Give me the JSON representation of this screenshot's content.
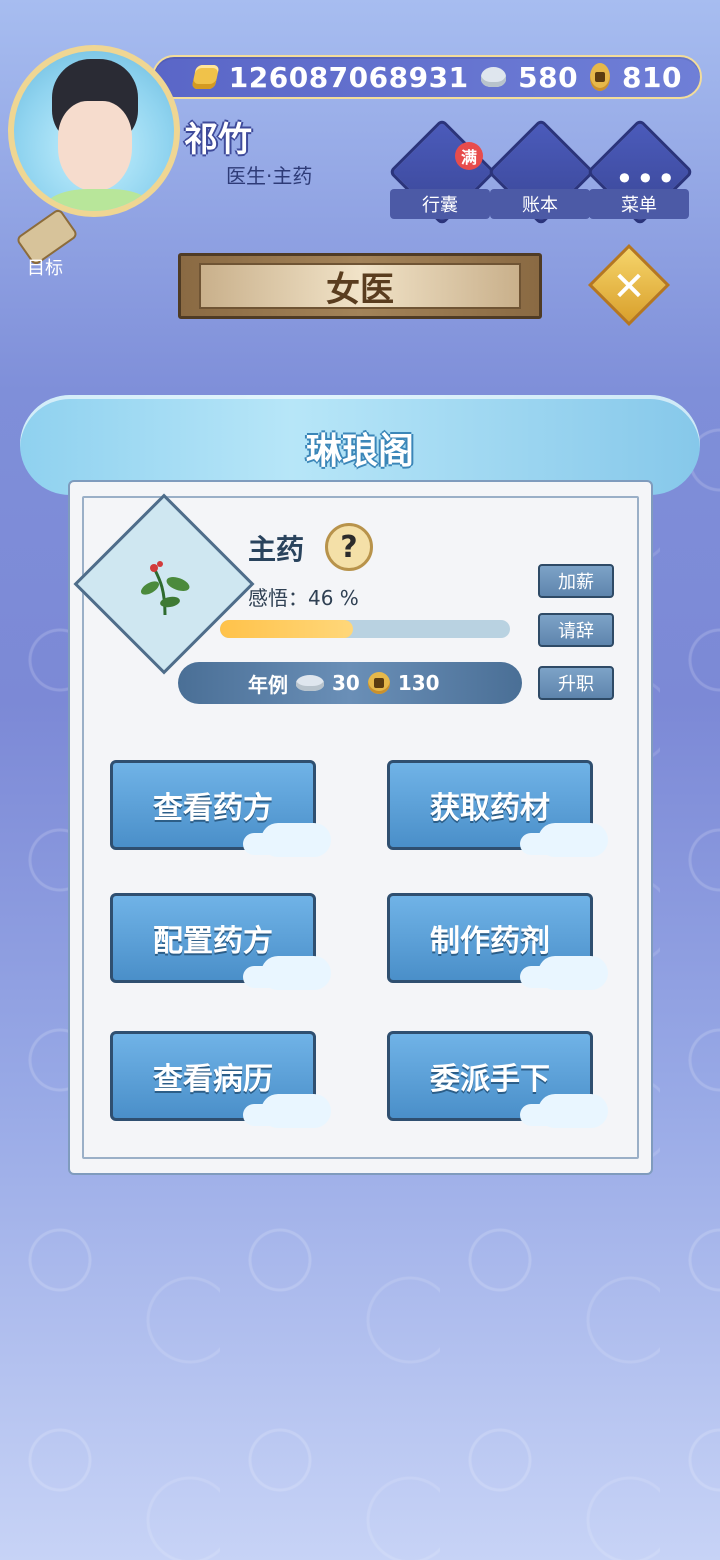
{
  "player": {
    "name": "祁竹",
    "role": "医生·主药",
    "currency": {
      "gold": "126087068931",
      "silver": "580",
      "coins": "810"
    }
  },
  "hud": {
    "buttons": [
      {
        "label": "行囊",
        "badge": "满"
      },
      {
        "label": "账本"
      },
      {
        "label": "菜单"
      }
    ],
    "target_label": "目标"
  },
  "screen": {
    "title": "女医",
    "close_symbol": "✕"
  },
  "panel": {
    "title": "琳琅阁",
    "position": "主药",
    "help_symbol": "?",
    "insight_text": "感悟：46 %",
    "insight_progress_percent": 46,
    "salary": {
      "label": "年例",
      "silver": "30",
      "coins": "130"
    },
    "side_buttons": [
      "加薪",
      "请辞",
      "升职"
    ],
    "actions": [
      "查看药方",
      "获取药材",
      "配置药方",
      "制作药剂",
      "查看病历",
      "委派手下"
    ]
  },
  "colors": {
    "accent_gold": "#efd693",
    "banner_text": "#5a3d1f",
    "button_blue": "#4a8fc9",
    "progress_fill": "#ffc24a"
  }
}
